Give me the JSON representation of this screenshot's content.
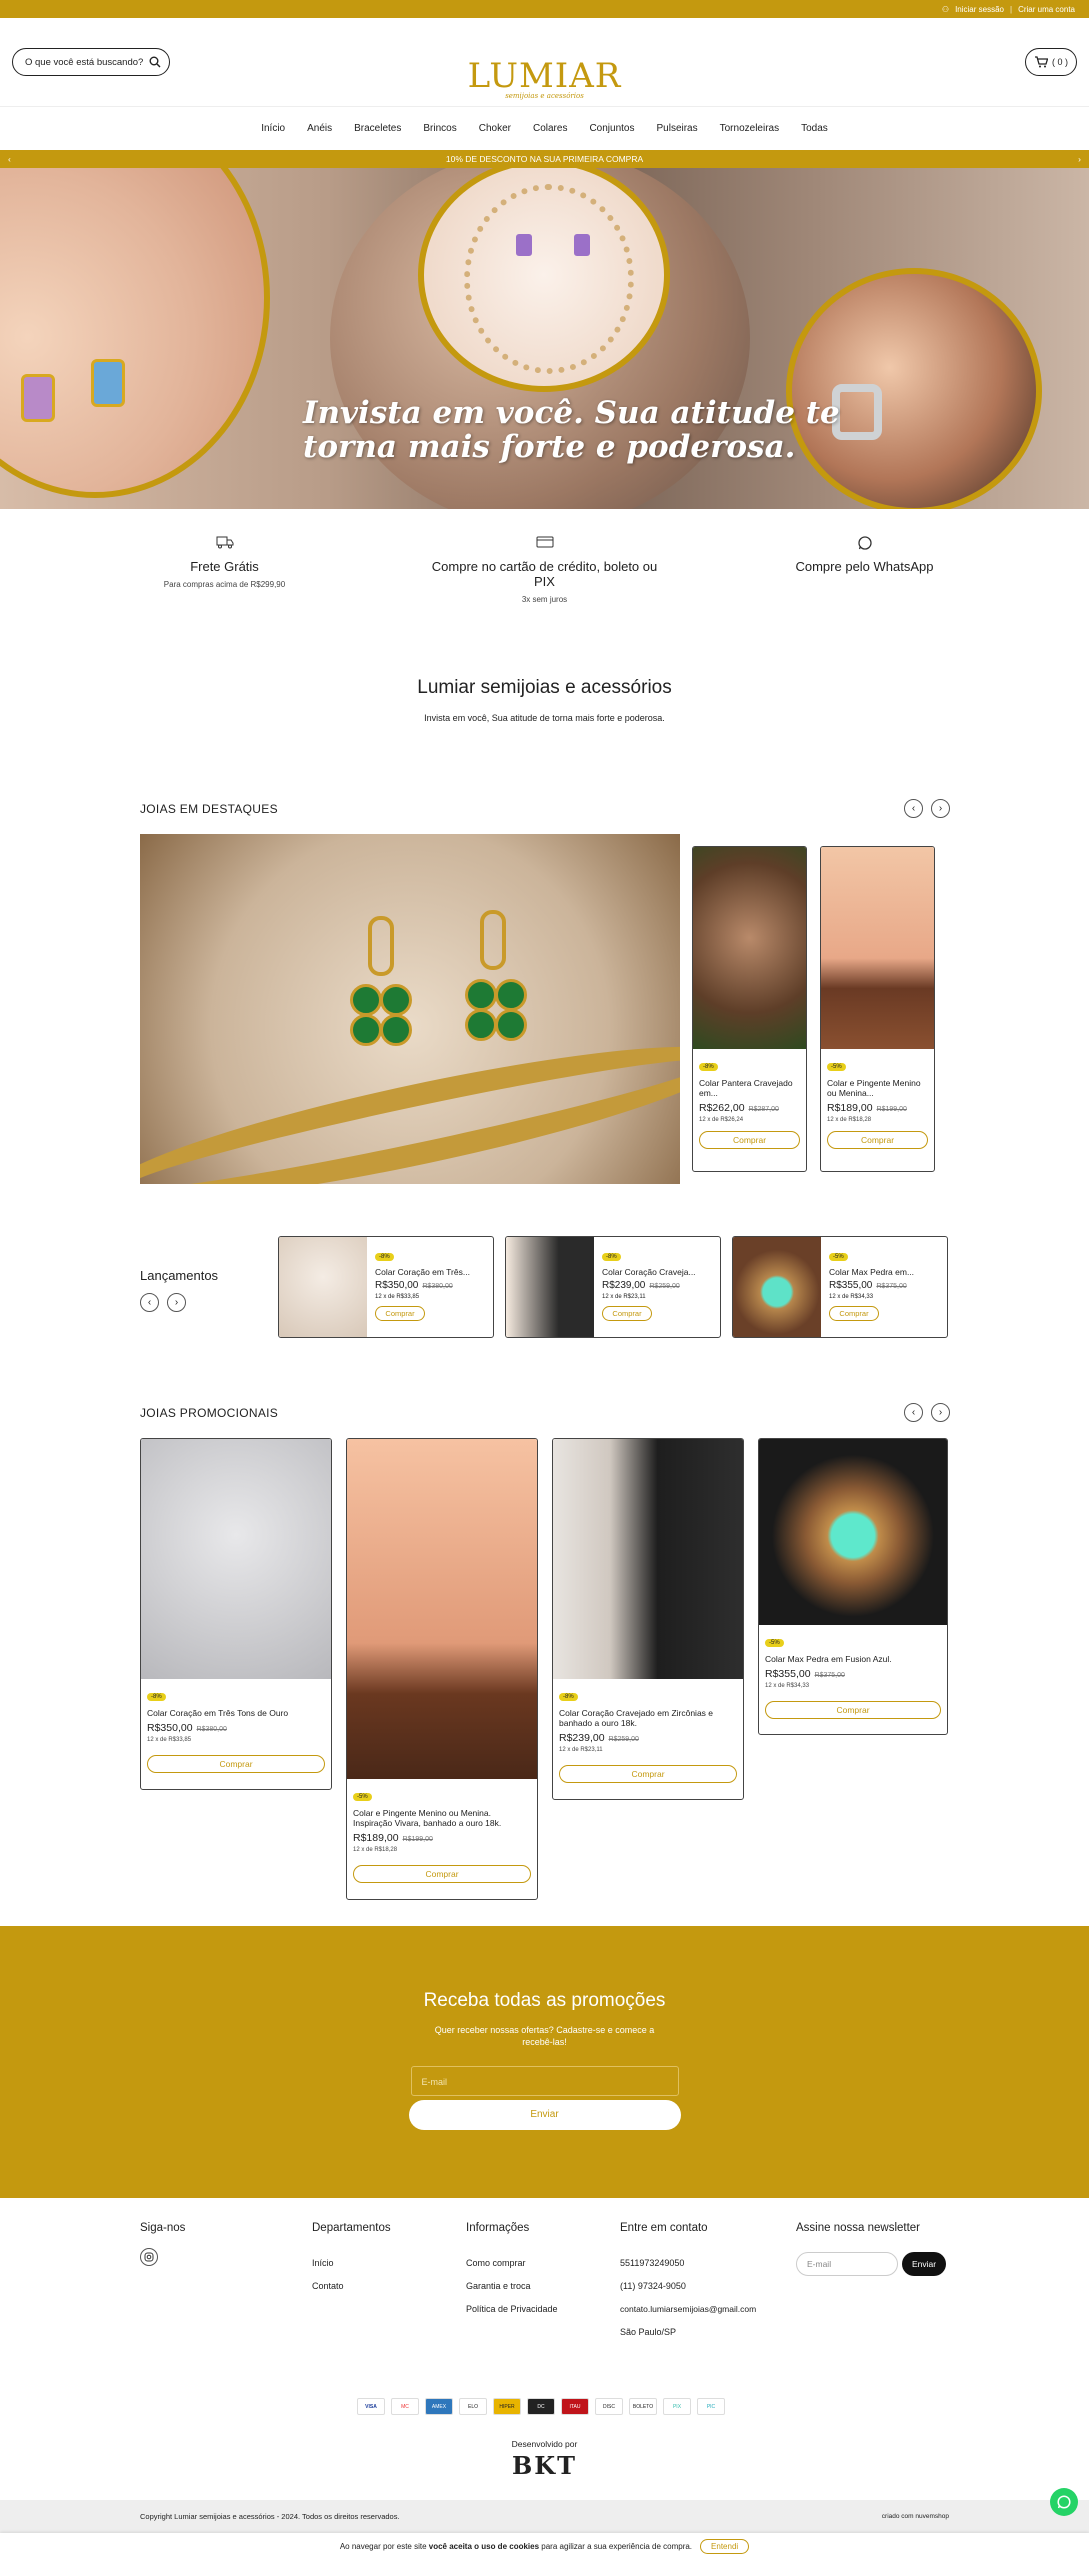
{
  "topbar": {
    "login": "Iniciar sessão",
    "sep": "|",
    "register": "Criar uma conta"
  },
  "header": {
    "search_placeholder": "O que você está buscando?",
    "logo_main": "LUMIAR",
    "logo_sub": "semijoias e acessórios",
    "cart_count": "( 0 )"
  },
  "nav": [
    "Início",
    "Anéis",
    "Braceletes",
    "Brincos",
    "Choker",
    "Colares",
    "Conjuntos",
    "Pulseiras",
    "Tornozeleiras",
    "Todas"
  ],
  "promo": {
    "text": "10% DE DESCONTO NA SUA PRIMEIRA COMPRA",
    "prev": "‹",
    "next": "›"
  },
  "banner": {
    "headline_1": "Invista em você. Sua atitude te",
    "headline_2": "torna mais forte e poderosa."
  },
  "benefits": [
    {
      "icon": "truck-icon",
      "title": "Frete Grátis",
      "sub": "Para compras acima de R$299,90"
    },
    {
      "icon": "credit-card-icon",
      "title": "Compre no cartão de crédito, boleto ou PIX",
      "sub": "3x sem juros"
    },
    {
      "icon": "whatsapp-icon",
      "title": "Compre pelo WhatsApp",
      "sub": ""
    }
  ],
  "intro": {
    "title": "Lumiar semijoias e acessórios",
    "text": "Invista em você, Sua atitude de torna mais forte e poderosa."
  },
  "featured": {
    "title": "JOIAS EM DESTAQUES",
    "cards": [
      {
        "badge": "-8%",
        "name": "Colar Pantera Cravejado em...",
        "price": "R$262,00",
        "old": "R$287,00",
        "inst": "12 x de R$26,24",
        "buy": "Comprar"
      },
      {
        "badge": "-5%",
        "name": "Colar e Pingente Menino ou Menina...",
        "price": "R$189,00",
        "old": "R$199,00",
        "inst": "12 x de R$18,28",
        "buy": "Comprar"
      }
    ]
  },
  "launches": {
    "title": "Lançamentos",
    "cards": [
      {
        "badge": "-8%",
        "name": "Colar Coração em Três...",
        "price": "R$350,00",
        "old": "R$380,00",
        "inst": "12 x de R$33,85",
        "buy": "Comprar"
      },
      {
        "badge": "-8%",
        "name": "Colar Coração Craveja...",
        "price": "R$239,00",
        "old": "R$259,00",
        "inst": "12 x de R$23,11",
        "buy": "Comprar"
      },
      {
        "badge": "-5%",
        "name": "Colar Max Pedra em...",
        "price": "R$355,00",
        "old": "R$375,00",
        "inst": "12 x de R$34,33",
        "buy": "Comprar"
      }
    ]
  },
  "promos": {
    "title": "JOIAS PROMOCIONAIS",
    "cards": [
      {
        "badge": "-8%",
        "name": "Colar Coração em Três Tons de Ouro",
        "price": "R$350,00",
        "old": "R$380,00",
        "inst": "12 x de R$33,85",
        "buy": "Comprar"
      },
      {
        "badge": "-5%",
        "name": "Colar e Pingente Menino ou Menina. Inspiração Vivara, banhado a ouro 18k.",
        "price": "R$189,00",
        "old": "R$199,00",
        "inst": "12 x de R$18,28",
        "buy": "Comprar"
      },
      {
        "badge": "-8%",
        "name": "Colar Coração Cravejado em Zircônias e banhado a ouro 18k.",
        "price": "R$239,00",
        "old": "R$259,00",
        "inst": "12 x de R$23,11",
        "buy": "Comprar"
      },
      {
        "badge": "-5%",
        "name": "Colar Max Pedra em Fusion Azul.",
        "price": "R$355,00",
        "old": "R$375,00",
        "inst": "12 x de R$34,33",
        "buy": "Comprar"
      }
    ]
  },
  "newsletter": {
    "title": "Receba todas as promoções",
    "text": "Quer receber nossas ofertas? Cadastre-se e comece a recebê-las!",
    "placeholder": "E-mail",
    "button": "Enviar"
  },
  "footer": {
    "follow": "Siga-nos",
    "departments": {
      "title": "Departamentos",
      "links": [
        "Início",
        "Contato"
      ]
    },
    "info": {
      "title": "Informações",
      "links": [
        "Como comprar",
        "Garantia e troca",
        "Política de Privacidade"
      ]
    },
    "contact": {
      "title": "Entre em contato",
      "lines": [
        "5511973249050",
        "(11) 97324-9050",
        "contato.lumiarsemijoias@gmail.com",
        "São Paulo/SP"
      ]
    },
    "newsletter": {
      "title": "Assine nossa newsletter",
      "placeholder": "E-mail",
      "button": "Enviar"
    },
    "payments": [
      "VISA",
      "MC",
      "AMEX",
      "ELO",
      "HIPER",
      "DC",
      "ITAU",
      "DISC",
      "BOLETO",
      "PIX",
      "PIC"
    ],
    "dev_label": "Desenvolvido por",
    "dev_name": "BKT",
    "copyright": "Copyright Lumiar semijoias e acessórios - 2024. Todos os direitos reservados.",
    "platform": "criado com nuvemshop"
  },
  "cookie": {
    "text_1": "Ao navegar por este site",
    "text_bold": "você aceita o uso de cookies",
    "text_2": "para agilizar a sua experiência de compra.",
    "button": "Entendi"
  },
  "colors": {
    "accent": "#c4990f",
    "badge": "#e8cf1a",
    "whatsapp": "#25d366"
  }
}
